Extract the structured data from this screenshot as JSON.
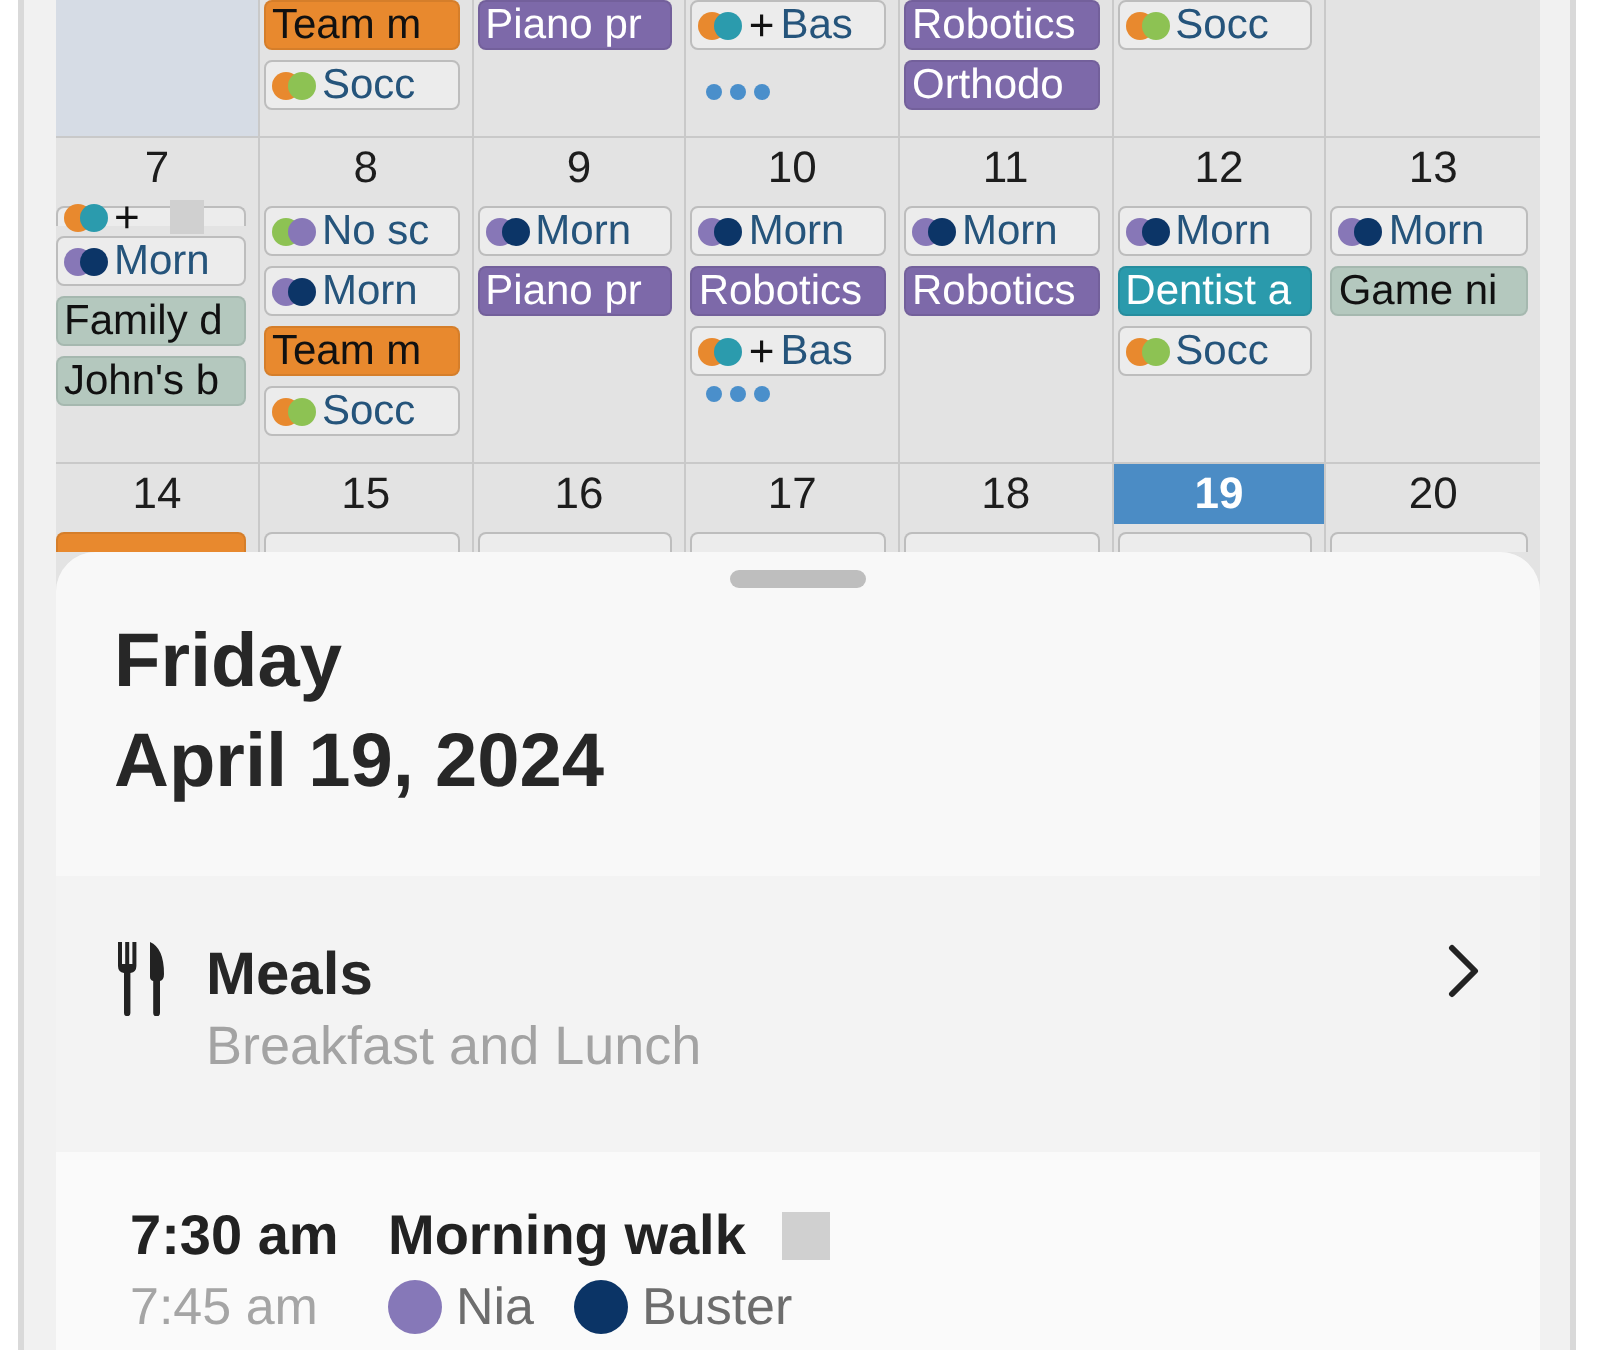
{
  "calendar": {
    "weeks": [
      {
        "days": [
          {
            "in_month": false,
            "selected": false,
            "more": false
          },
          {
            "in_month": true,
            "selected": false,
            "more": false,
            "events": [
              {
                "kind": "filled",
                "color": "#e8892e",
                "title": "Team m"
              },
              {
                "kind": "dots",
                "members": [
                  {
                    "color": "#e8892e"
                  },
                  {
                    "color": "#8dc253"
                  }
                ],
                "title": "Socc"
              }
            ]
          },
          {
            "in_month": true,
            "selected": false,
            "more": false,
            "events": [
              {
                "kind": "filled",
                "color": "#7d69a9",
                "title": "Piano pr"
              }
            ]
          },
          {
            "in_month": true,
            "selected": false,
            "more": true,
            "events": [
              {
                "kind": "dots",
                "members": [
                  {
                    "color": "#e8892e"
                  },
                  {
                    "color": "#2b9bad"
                  }
                ],
                "plus": "+",
                "title": "Bas"
              }
            ]
          },
          {
            "in_month": true,
            "selected": false,
            "more": false,
            "events": [
              {
                "kind": "filled",
                "color": "#7d69a9",
                "title": "Robotics"
              },
              {
                "kind": "filled",
                "color": "#7d69a9",
                "title": "Orthodo"
              }
            ]
          },
          {
            "in_month": true,
            "selected": false,
            "more": false,
            "events": [
              {
                "kind": "dots",
                "members": [
                  {
                    "color": "#e8892e"
                  },
                  {
                    "color": "#8dc253"
                  }
                ],
                "title": "Socc"
              }
            ]
          },
          {
            "in_month": true,
            "selected": false,
            "more": false
          }
        ]
      },
      {
        "days": [
          {
            "day": "7",
            "in_month": true,
            "selected": false,
            "more": false,
            "events": [
              {
                "kind": "dots",
                "members": [
                  {
                    "color": "#e8892e"
                  },
                  {
                    "color": "#2b9bad"
                  }
                ],
                "plus": "+",
                "square_mark": true
              },
              {
                "kind": "dots",
                "members": [
                  {
                    "color": "#8777b7"
                  },
                  {
                    "color": "#0c3567"
                  }
                ],
                "title": "Morn"
              },
              {
                "kind": "filled",
                "color": "#b4c8be",
                "title": "Family d"
              },
              {
                "kind": "filled",
                "color": "#b4c8be",
                "title": "John's b"
              }
            ]
          },
          {
            "day": "8",
            "in_month": true,
            "selected": false,
            "more": false,
            "events": [
              {
                "kind": "dots",
                "members": [
                  {
                    "color": "#8dc253"
                  },
                  {
                    "color": "#8777b7"
                  }
                ],
                "title": "No sc"
              },
              {
                "kind": "dots",
                "members": [
                  {
                    "color": "#8777b7"
                  },
                  {
                    "color": "#0c3567"
                  }
                ],
                "title": "Morn"
              },
              {
                "kind": "filled",
                "color": "#e8892e",
                "title": "Team m"
              },
              {
                "kind": "dots",
                "members": [
                  {
                    "color": "#e8892e"
                  },
                  {
                    "color": "#8dc253"
                  }
                ],
                "title": "Socc"
              }
            ]
          },
          {
            "day": "9",
            "in_month": true,
            "selected": false,
            "more": false,
            "events": [
              {
                "kind": "dots",
                "members": [
                  {
                    "color": "#8777b7"
                  },
                  {
                    "color": "#0c3567"
                  }
                ],
                "title": "Morn"
              },
              {
                "kind": "filled",
                "color": "#7d69a9",
                "title": "Piano pr"
              }
            ]
          },
          {
            "day": "10",
            "in_month": true,
            "selected": false,
            "more": true,
            "events": [
              {
                "kind": "dots",
                "members": [
                  {
                    "color": "#8777b7"
                  },
                  {
                    "color": "#0c3567"
                  }
                ],
                "title": "Morn"
              },
              {
                "kind": "filled",
                "color": "#7d69a9",
                "title": "Robotics"
              },
              {
                "kind": "dots",
                "members": [
                  {
                    "color": "#e8892e"
                  },
                  {
                    "color": "#2b9bad"
                  }
                ],
                "plus": "+",
                "title": "Bas"
              }
            ]
          },
          {
            "day": "11",
            "in_month": true,
            "selected": false,
            "more": false,
            "events": [
              {
                "kind": "dots",
                "members": [
                  {
                    "color": "#8777b7"
                  },
                  {
                    "color": "#0c3567"
                  }
                ],
                "title": "Morn"
              },
              {
                "kind": "filled",
                "color": "#7d69a9",
                "title": "Robotics"
              }
            ]
          },
          {
            "day": "12",
            "in_month": true,
            "selected": false,
            "more": false,
            "events": [
              {
                "kind": "dots",
                "members": [
                  {
                    "color": "#8777b7"
                  },
                  {
                    "color": "#0c3567"
                  }
                ],
                "title": "Morn"
              },
              {
                "kind": "filled",
                "color": "#2a9aac",
                "title": "Dentist a"
              },
              {
                "kind": "dots",
                "members": [
                  {
                    "color": "#e8892e"
                  },
                  {
                    "color": "#8dc253"
                  }
                ],
                "title": "Socc"
              }
            ]
          },
          {
            "day": "13",
            "in_month": true,
            "selected": false,
            "more": false,
            "events": [
              {
                "kind": "dots",
                "members": [
                  {
                    "color": "#8777b7"
                  },
                  {
                    "color": "#0c3567"
                  }
                ],
                "title": "Morn"
              },
              {
                "kind": "filled",
                "color": "#b4c8be",
                "title": "Game ni"
              }
            ]
          }
        ]
      },
      {
        "days": [
          {
            "day": "14",
            "in_month": true,
            "selected": false,
            "more": false,
            "events": [
              {
                "kind": "filled",
                "color": "#e8892e"
              }
            ]
          },
          {
            "day": "15",
            "in_month": true,
            "selected": false,
            "more": false,
            "events": [
              {
                "kind": "dots"
              }
            ]
          },
          {
            "day": "16",
            "in_month": true,
            "selected": false,
            "more": false,
            "events": [
              {
                "kind": "dots"
              }
            ]
          },
          {
            "day": "17",
            "in_month": true,
            "selected": false,
            "more": false,
            "events": [
              {
                "kind": "dots"
              }
            ]
          },
          {
            "day": "18",
            "in_month": true,
            "selected": false,
            "more": false,
            "events": [
              {
                "kind": "dots"
              }
            ]
          },
          {
            "day": "19",
            "in_month": true,
            "selected": true,
            "more": false,
            "events": [
              {
                "kind": "dots"
              }
            ]
          },
          {
            "day": "20",
            "in_month": true,
            "selected": false,
            "more": false,
            "events": [
              {
                "kind": "dots"
              }
            ]
          }
        ]
      }
    ]
  },
  "sheet": {
    "weekday": "Friday",
    "date": "April 19, 2024",
    "meals": {
      "title": "Meals",
      "subtitle": "Breakfast and Lunch"
    },
    "events": [
      {
        "start": "7:30 am",
        "end": "7:45 am",
        "title": "Morning walk",
        "square_mark": true,
        "people": [
          {
            "name": "Nia",
            "color": "#8678b8"
          },
          {
            "name": "Buster",
            "color": "#0b3466"
          }
        ]
      }
    ]
  }
}
